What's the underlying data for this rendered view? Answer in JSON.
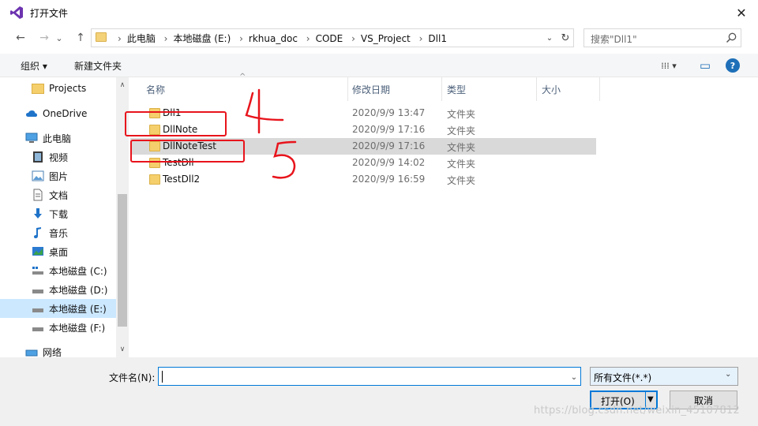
{
  "window": {
    "title": "打开文件",
    "close_glyph": "✕"
  },
  "nav": {
    "back_icon": "←",
    "forward_icon": "→",
    "dropdown_icon": "⌄",
    "up_icon": "↑",
    "breadcrumbs": [
      "此电脑",
      "本地磁盘 (E:)",
      "rkhua_doc",
      "CODE",
      "VS_Project",
      "Dll1"
    ],
    "separator": "›",
    "refresh_icon": "↻",
    "search_placeholder": "搜索\"Dll1\""
  },
  "toolbar": {
    "organize_label": "组织 ▾",
    "new_folder_label": "新建文件夹",
    "view_icon": "⁞⁞⁞ ▾",
    "pane_icon": "▭",
    "help_icon": "?"
  },
  "sidebar": {
    "items": [
      {
        "label": "Projects",
        "icon": "folder-icon"
      },
      {
        "label": "OneDrive",
        "icon": "cloud-icon"
      },
      {
        "label": "此电脑",
        "icon": "computer-icon"
      },
      {
        "label": "视频",
        "icon": "video-icon"
      },
      {
        "label": "图片",
        "icon": "picture-icon"
      },
      {
        "label": "文档",
        "icon": "document-icon"
      },
      {
        "label": "下载",
        "icon": "download-icon"
      },
      {
        "label": "音乐",
        "icon": "music-icon"
      },
      {
        "label": "桌面",
        "icon": "desktop-icon"
      },
      {
        "label": "本地磁盘 (C:)",
        "icon": "drive-icon"
      },
      {
        "label": "本地磁盘 (D:)",
        "icon": "drive-icon"
      },
      {
        "label": "本地磁盘 (E:)",
        "icon": "drive-icon"
      },
      {
        "label": "本地磁盘 (F:)",
        "icon": "drive-icon"
      },
      {
        "label": "网络",
        "icon": "network-icon"
      }
    ],
    "selected_index": 11
  },
  "columns": {
    "name": "名称",
    "date": "修改日期",
    "type": "类型",
    "size": "大小"
  },
  "files": [
    {
      "name": "Dll1",
      "date": "2020/9/9 13:47",
      "type": "文件夹"
    },
    {
      "name": "DllNote",
      "date": "2020/9/9 17:16",
      "type": "文件夹"
    },
    {
      "name": "DllNoteTest",
      "date": "2020/9/9 17:16",
      "type": "文件夹"
    },
    {
      "name": "TestDll",
      "date": "2020/9/9 14:02",
      "type": "文件夹"
    },
    {
      "name": "TestDll2",
      "date": "2020/9/9 16:59",
      "type": "文件夹"
    }
  ],
  "highlighted_file_index": 2,
  "annotations": {
    "mark_4": "4",
    "mark_5": "5",
    "color": "#e8141c"
  },
  "bottom": {
    "filename_label": "文件名(N):",
    "filename_value": "",
    "filter_value": "所有文件(*.*)",
    "open_label": "打开(O)",
    "cancel_label": "取消"
  },
  "watermark": "https://blog.csdn.net/weixin_45107812"
}
